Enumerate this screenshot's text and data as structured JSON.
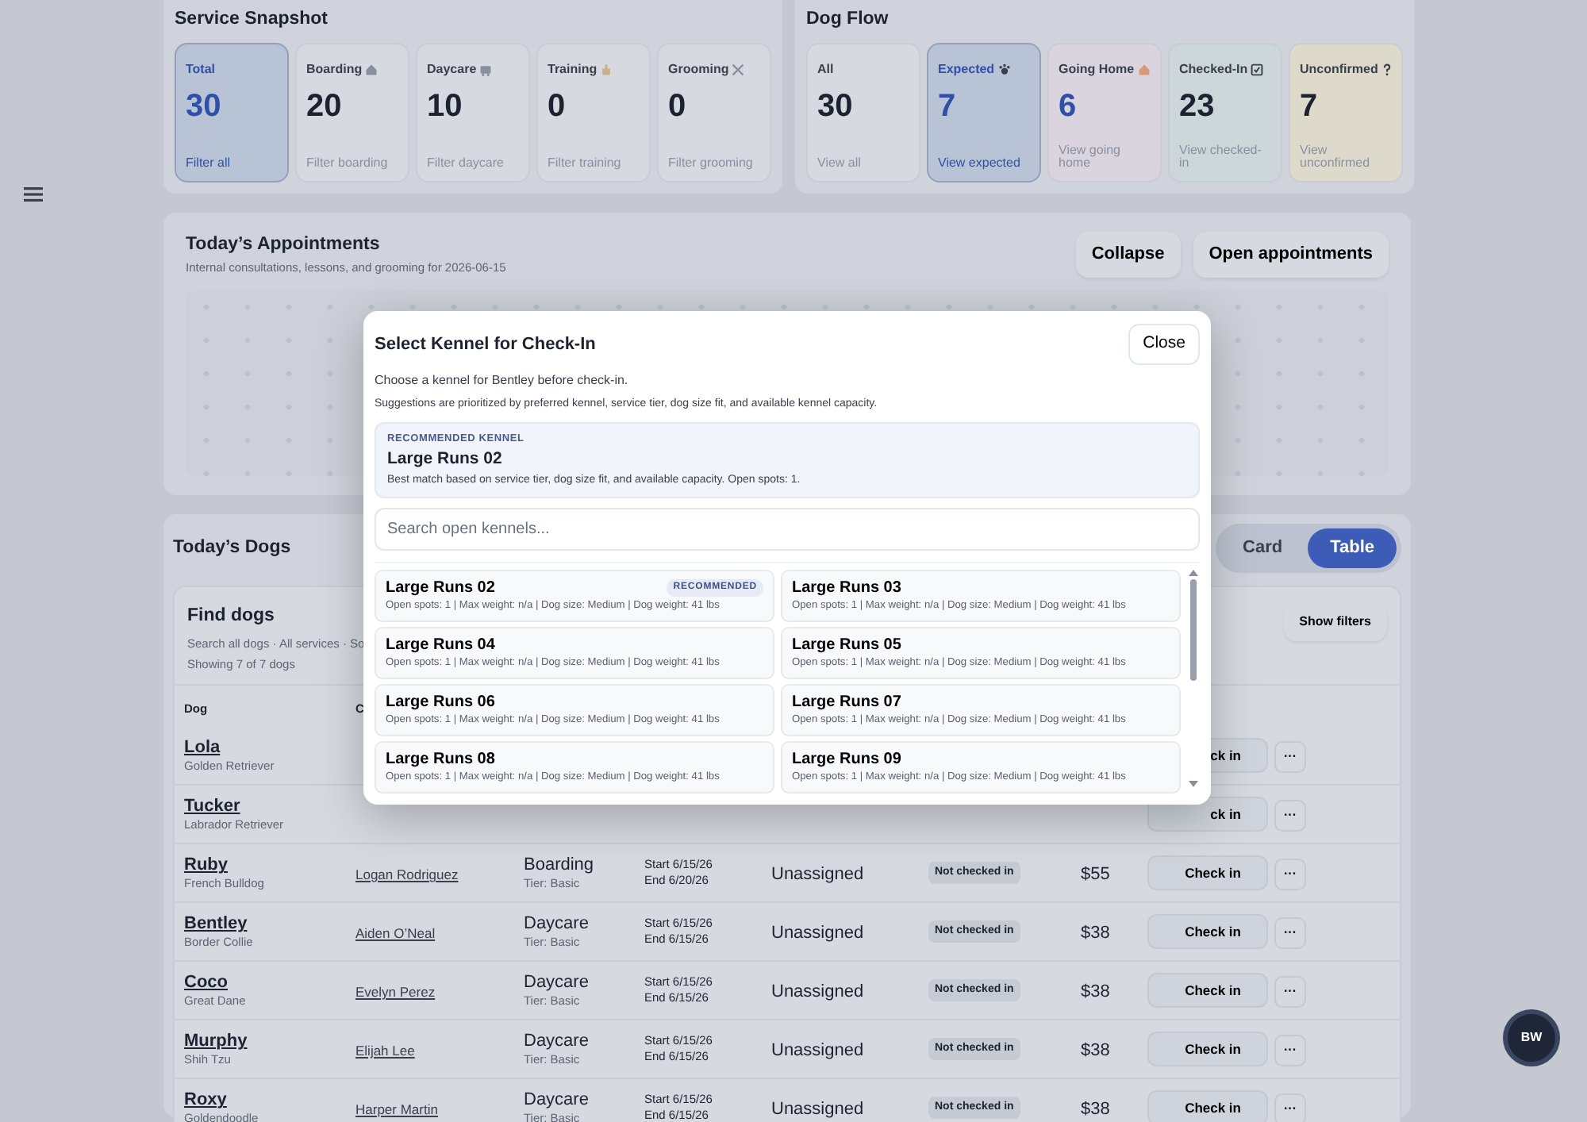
{
  "service_snapshot": {
    "title": "Service Snapshot",
    "cards": [
      {
        "label": "Total",
        "count": "30",
        "link": "Filter all",
        "selected": true
      },
      {
        "label": "Boarding",
        "count": "20",
        "link": "Filter boarding",
        "selected": false
      },
      {
        "label": "Daycare",
        "count": "10",
        "link": "Filter daycare",
        "selected": false
      },
      {
        "label": "Training",
        "count": "0",
        "link": "Filter training",
        "selected": false
      },
      {
        "label": "Grooming",
        "count": "0",
        "link": "Filter grooming",
        "selected": false
      }
    ]
  },
  "dog_flow": {
    "title": "Dog Flow",
    "cards": [
      {
        "label": "All",
        "count": "30",
        "link": "View all",
        "selected": false,
        "color": "#d6d9e0"
      },
      {
        "label": "Expected",
        "count": "7",
        "link": "View expected",
        "selected": true,
        "color": "#b9c5da"
      },
      {
        "label": "Going Home",
        "count": "6",
        "link": "View going home",
        "selected": false,
        "color": "#d9d4de"
      },
      {
        "label": "Checked-In",
        "count": "23",
        "link": "View checked-in",
        "selected": false,
        "color": "#cdd7d9"
      },
      {
        "label": "Unconfirmed",
        "count": "7",
        "link": "View unconfirmed",
        "selected": false,
        "color": "#dedacb"
      }
    ]
  },
  "appointments": {
    "title": "Today’s Appointments",
    "subtitle": "Internal consultations, lessons, and grooming for 2026-06-15",
    "buttons": [
      "Collapse",
      "Open appointments"
    ]
  },
  "todays_dogs": {
    "title": "Today’s Dogs",
    "view_toggle": [
      {
        "label": "Card",
        "selected": false
      },
      {
        "label": "Table",
        "selected": true
      }
    ],
    "find": {
      "title": "Find dogs",
      "subtitle": "Search all dogs · All services · So",
      "showing": "Showing 7 of 7 dogs",
      "filter_button": "Show filters"
    },
    "columns": [
      "Dog",
      "C"
    ],
    "rows": [
      {
        "name": "Lola",
        "breed": "Golden Retriever",
        "action": "ck in",
        "more": "···"
      },
      {
        "name": "Tucker",
        "breed": "Labrador Retriever",
        "action": "ck in",
        "more": "···"
      },
      {
        "name": "Ruby",
        "breed": "French Bulldog",
        "owner": "Logan Rodriguez",
        "service": "Boarding",
        "tier": "Tier: Basic",
        "start": "Start 6/15/26",
        "end": "End 6/20/26",
        "kennel": "Unassigned",
        "status": "Not checked in",
        "price": "$55",
        "action": "Check in",
        "more": "···"
      },
      {
        "name": "Bentley",
        "breed": "Border Collie",
        "owner": "Aiden O’Neal",
        "service": "Daycare",
        "tier": "Tier: Basic",
        "start": "Start 6/15/26",
        "end": "End 6/15/26",
        "kennel": "Unassigned",
        "status": "Not checked in",
        "price": "$38",
        "action": "Check in",
        "more": "···"
      },
      {
        "name": "Coco",
        "breed": "Great Dane",
        "owner": "Evelyn Perez",
        "service": "Daycare",
        "tier": "Tier: Basic",
        "start": "Start 6/15/26",
        "end": "End 6/15/26",
        "kennel": "Unassigned",
        "status": "Not checked in",
        "price": "$38",
        "action": "Check in",
        "more": "···"
      },
      {
        "name": "Murphy",
        "breed": "Shih Tzu",
        "owner": "Elijah Lee",
        "service": "Daycare",
        "tier": "Tier: Basic",
        "start": "Start 6/15/26",
        "end": "End 6/15/26",
        "kennel": "Unassigned",
        "status": "Not checked in",
        "price": "$38",
        "action": "Check in",
        "more": "···"
      },
      {
        "name": "Roxy",
        "breed": "Goldendoodle",
        "owner": "Harper Martin",
        "service": "Daycare",
        "tier": "Tier: Basic",
        "start": "Start 6/15/26",
        "end": "End 6/15/26",
        "kennel": "Unassigned",
        "status": "Not checked in",
        "price": "$38",
        "action": "Check in",
        "more": "···"
      }
    ]
  },
  "modal": {
    "title": "Select Kennel for Check-In",
    "close": "Close",
    "intro": "Choose a kennel for Bentley before check-in.",
    "note": "Suggestions are prioritized by preferred kennel, service tier, dog size fit, and available kennel capacity.",
    "recommended": {
      "label": "RECOMMENDED KENNEL",
      "name": "Large Runs 02",
      "detail": "Best match based on service tier, dog size fit, and available capacity. Open spots: 1."
    },
    "search": {
      "placeholder": "Search open kennels..."
    },
    "kennels": [
      {
        "name": "Large Runs 02",
        "badge": "RECOMMENDED",
        "detail": "Open spots: 1 | Max weight: n/a | Dog size: Medium | Dog weight: 41 lbs"
      },
      {
        "name": "Large Runs 03",
        "detail": "Open spots: 1 | Max weight: n/a | Dog size: Medium | Dog weight: 41 lbs"
      },
      {
        "name": "Large Runs 04",
        "detail": "Open spots: 1 | Max weight: n/a | Dog size: Medium | Dog weight: 41 lbs"
      },
      {
        "name": "Large Runs 05",
        "detail": "Open spots: 1 | Max weight: n/a | Dog size: Medium | Dog weight: 41 lbs"
      },
      {
        "name": "Large Runs 06",
        "detail": "Open spots: 1 | Max weight: n/a | Dog size: Medium | Dog weight: 41 lbs"
      },
      {
        "name": "Large Runs 07",
        "detail": "Open spots: 1 | Max weight: n/a | Dog size: Medium | Dog weight: 41 lbs"
      },
      {
        "name": "Large Runs 08",
        "detail": "Open spots: 1 | Max weight: n/a | Dog size: Medium | Dog weight: 41 lbs"
      },
      {
        "name": "Large Runs 09",
        "detail": "Open spots: 1 | Max weight: n/a | Dog size: Medium | Dog weight: 41 lbs"
      }
    ]
  },
  "avatar": {
    "initials": "BW"
  }
}
